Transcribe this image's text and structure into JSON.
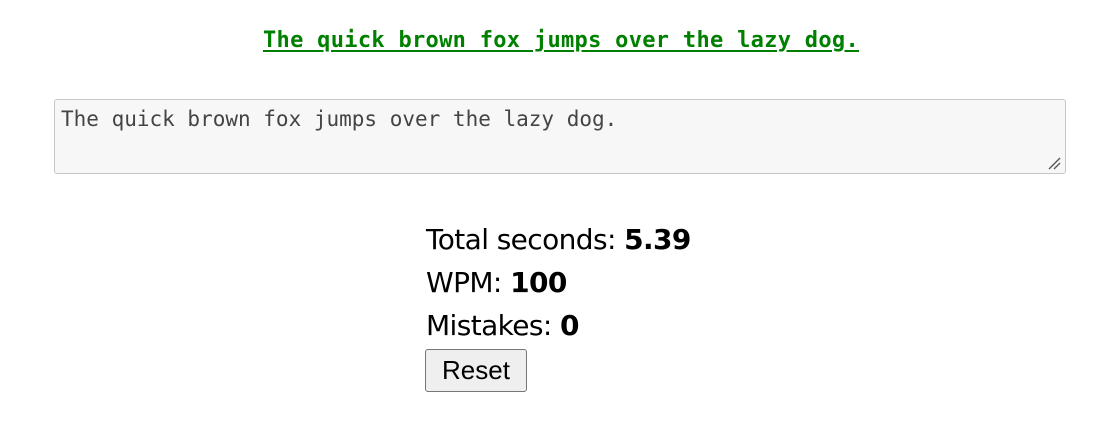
{
  "prompt": {
    "text": "The quick brown fox jumps over the lazy dog.",
    "color": "#008000"
  },
  "typing_area": {
    "value": "The quick brown fox jumps over the lazy dog."
  },
  "stats": {
    "total_seconds_label": "Total seconds: ",
    "total_seconds_value": "5.39",
    "wpm_label": "WPM: ",
    "wpm_value": "100",
    "mistakes_label": "Mistakes: ",
    "mistakes_value": "0"
  },
  "reset_button": {
    "label": "Reset"
  },
  "icons": {
    "resize_grip": "resize-grip-icon"
  }
}
